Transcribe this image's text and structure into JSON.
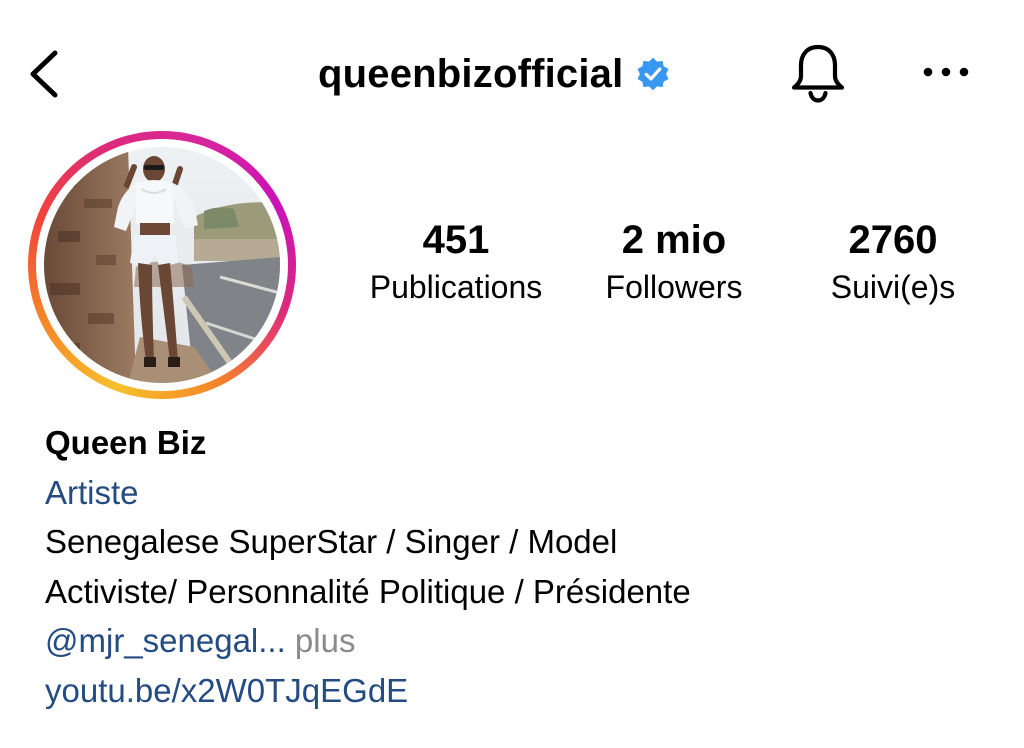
{
  "header": {
    "username": "queenbizofficial",
    "verified": true,
    "icons": [
      "back-icon",
      "verified-badge-icon",
      "bell-icon",
      "more-options-icon"
    ]
  },
  "colors": {
    "text": "#000000",
    "link": "#244c82",
    "muted": "#8a8a8a",
    "verified_badge": "#3897f0",
    "story_ring": [
      "#f7c12b",
      "#f58529",
      "#dd2a7b",
      "#c913b9"
    ]
  },
  "stats": {
    "posts": {
      "value": "451",
      "label": "Publications"
    },
    "followers": {
      "value": "2 mio",
      "label": "Followers"
    },
    "following": {
      "value": "2760",
      "label": "Suivi(e)s"
    }
  },
  "bio": {
    "display_name": "Queen Biz",
    "category": "Artiste",
    "lines": [
      "Senegalese SuperStar / Singer / Model",
      "Activiste/ Personnalité Politique / Présidente"
    ],
    "mention": "@mjr_senegal...",
    "more_label": " plus",
    "link": "youtu.be/x2W0TJqEGdE"
  }
}
